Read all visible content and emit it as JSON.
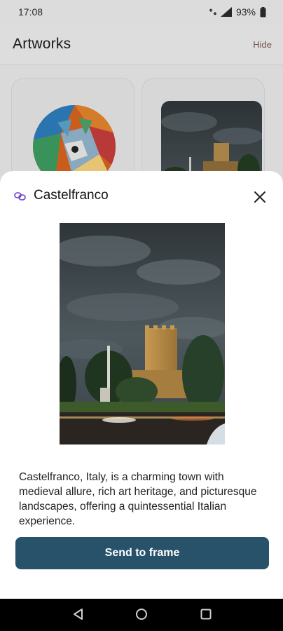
{
  "status_bar": {
    "time": "17:08",
    "battery": "93%"
  },
  "header": {
    "title": "Artworks",
    "hide_label": "Hide"
  },
  "sheet": {
    "title": "Castelfranco",
    "description": "Castelfranco, Italy, is a charming town with medieval allure, rich art heritage, and picturesque landscapes, offering a quintessential Italian experience.",
    "send_label": "Send to frame"
  },
  "colors": {
    "primary_button": "#28516a",
    "link_icon": "#6c3dd6",
    "hide_link": "#7a5a4c"
  },
  "icons": {
    "sheet_link": "link-icon",
    "close": "close-icon",
    "nav_back": "back-triangle-icon",
    "nav_home": "home-circle-icon",
    "nav_recents": "recents-square-icon"
  }
}
